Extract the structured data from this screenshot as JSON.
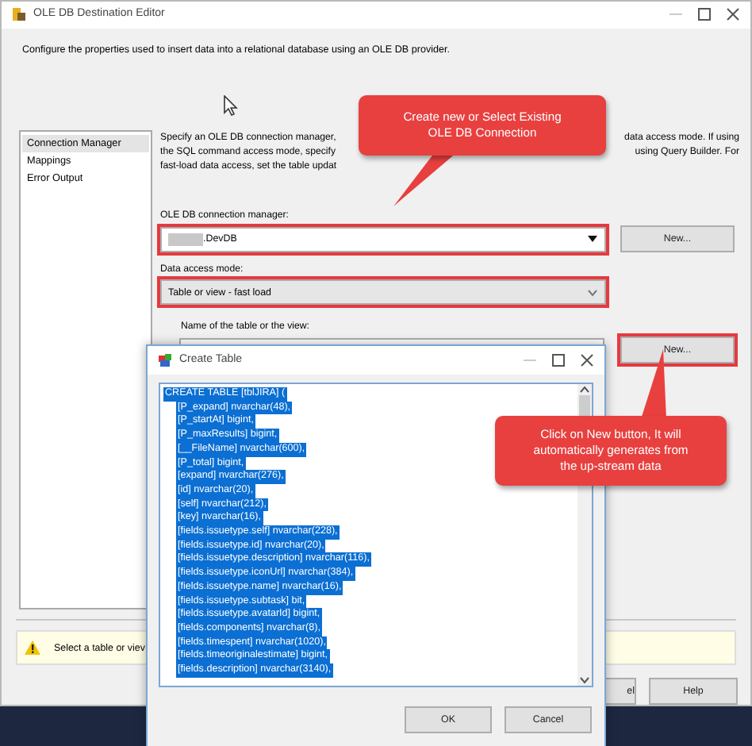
{
  "window": {
    "title": "OLE DB Destination Editor"
  },
  "description": "Configure the properties used to insert data into a relational database using an OLE DB provider.",
  "sidebar": {
    "items": [
      {
        "label": "Connection Manager",
        "selected": true
      },
      {
        "label": "Mappings",
        "selected": false
      },
      {
        "label": "Error Output",
        "selected": false
      }
    ]
  },
  "intro_fragments": [
    {
      "left": "Specify an OLE DB connection manager,",
      "right": "data access mode. If using"
    },
    {
      "left": "the SQL command access mode, specify",
      "right": "using Query Builder. For"
    },
    {
      "left": "fast-load data access, set the table updat"
    }
  ],
  "connection_manager": {
    "label": "OLE DB connection manager:",
    "value": ".DevDB",
    "highlighted": true,
    "button": "New..."
  },
  "access_mode": {
    "label": "Data access mode:",
    "value": "Table or view - fast load",
    "highlighted": true
  },
  "table_name": {
    "label": "Name of the table or the view:",
    "button": "New...",
    "button_highlighted": true
  },
  "warning": "Select a table or viev",
  "footer_buttons": [
    "el",
    "Help"
  ],
  "callouts": [
    {
      "lines": [
        "Create new or Select Existing",
        "OLE DB Connection"
      ]
    },
    {
      "lines": [
        "Click on New button, It will",
        "automatically generates from",
        "the up-stream data"
      ]
    }
  ],
  "create_table": {
    "title": "Create Table",
    "selected": true,
    "lines": [
      "CREATE TABLE [tblJIRA] (",
      "[P_expand] nvarchar(48),",
      "[P_startAt] bigint,",
      "[P_maxResults] bigint,",
      "[__FileName] nvarchar(600),",
      "[P_total] bigint,",
      "[expand] nvarchar(276),",
      "[id] nvarchar(20),",
      "[self] nvarchar(212),",
      "[key] nvarchar(16),",
      "[fields.issuetype.self] nvarchar(228),",
      "[fields.issuetype.id] nvarchar(20),",
      "[fields.issuetype.description] nvarchar(116),",
      "[fields.issuetype.iconUrl] nvarchar(384),",
      "[fields.issuetype.name] nvarchar(16),",
      "[fields.issuetype.subtask] bit,",
      "[fields.issuetype.avatarId] bigint,",
      "[fields.components] nvarchar(8),",
      "[fields.timespent] nvarchar(1020),",
      "[fields.timeoriginalestimate] bigint,",
      "[fields.description] nvarchar(3140),"
    ],
    "buttons": [
      "OK",
      "Cancel"
    ]
  }
}
